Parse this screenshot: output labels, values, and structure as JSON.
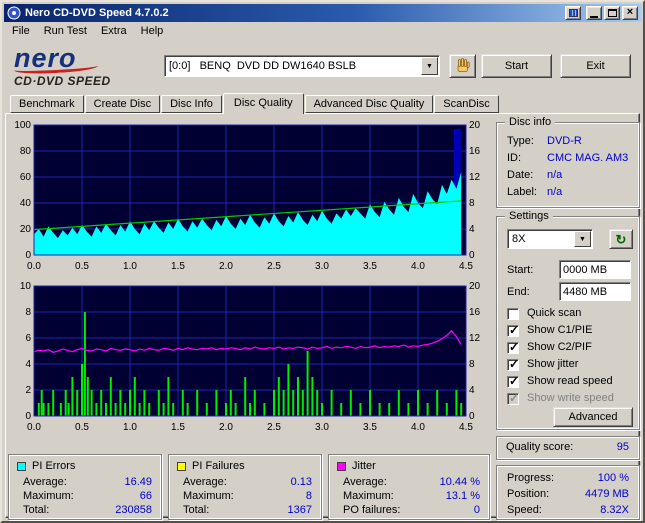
{
  "window": {
    "title": "Nero CD-DVD Speed 4.7.0.2"
  },
  "menu": {
    "items": [
      "File",
      "Run Test",
      "Extra",
      "Help"
    ]
  },
  "logo": {
    "brand": "nero",
    "product": "CD·DVD SPEED"
  },
  "toolbar": {
    "drive": "[0:0]   BENQ  DVD DD DW1640 BSLB",
    "start": "Start",
    "exit": "Exit"
  },
  "icons": {
    "chevron_down": "▼",
    "close": "×",
    "refresh": "↻"
  },
  "tabs": [
    {
      "label": "Benchmark",
      "active": false
    },
    {
      "label": "Create Disc",
      "active": false
    },
    {
      "label": "Disc Info",
      "active": false
    },
    {
      "label": "Disc Quality",
      "active": true
    },
    {
      "label": "Advanced Disc Quality",
      "active": false
    },
    {
      "label": "ScanDisc",
      "active": false
    }
  ],
  "disc_info": {
    "title": "Disc info",
    "rows": [
      {
        "label": "Type:",
        "value": "DVD-R"
      },
      {
        "label": "ID:",
        "value": "CMC MAG. AM3"
      },
      {
        "label": "Date:",
        "value": "n/a"
      },
      {
        "label": "Label:",
        "value": "n/a"
      }
    ]
  },
  "settings": {
    "title": "Settings",
    "speed": "8X",
    "start_label": "Start:",
    "start_value": "0000 MB",
    "end_label": "End:",
    "end_value": "4480 MB",
    "checkboxes": [
      {
        "label": "Quick scan",
        "checked": false,
        "disabled": false
      },
      {
        "label": "Show C1/PIE",
        "checked": true,
        "disabled": false
      },
      {
        "label": "Show C2/PIF",
        "checked": true,
        "disabled": false
      },
      {
        "label": "Show jitter",
        "checked": true,
        "disabled": false
      },
      {
        "label": "Show read speed",
        "checked": true,
        "disabled": false
      },
      {
        "label": "Show write speed",
        "checked": true,
        "disabled": true
      }
    ],
    "advanced": "Advanced"
  },
  "quality": {
    "label": "Quality score:",
    "value": "95"
  },
  "progress": {
    "rows": [
      {
        "label": "Progress:",
        "value": "100 %"
      },
      {
        "label": "Position:",
        "value": "4479 MB"
      },
      {
        "label": "Speed:",
        "value": "8.32X"
      }
    ]
  },
  "stats": [
    {
      "name": "PI Errors",
      "color": "#00ffff",
      "rows": [
        {
          "label": "Average:",
          "value": "16.49"
        },
        {
          "label": "Maximum:",
          "value": "66"
        },
        {
          "label": "Total:",
          "value": "230858"
        }
      ]
    },
    {
      "name": "PI Failures",
      "color": "#ffff00",
      "rows": [
        {
          "label": "Average:",
          "value": "0.13"
        },
        {
          "label": "Maximum:",
          "value": "8"
        },
        {
          "label": "Total:",
          "value": "1367"
        }
      ]
    },
    {
      "name": "Jitter",
      "color": "#ff00ff",
      "rows": [
        {
          "label": "Average:",
          "value": "10.44 %"
        },
        {
          "label": "Maximum:",
          "value": "13.1 %"
        },
        {
          "label": "PO failures:",
          "value": "0"
        }
      ]
    }
  ],
  "chart_data": [
    {
      "id": "pie",
      "type": "area",
      "title": "PI Errors / read speed",
      "bg": "#000033",
      "grid": "#2222b0",
      "x_min": 0,
      "x_max": 4.5,
      "x_ticks": [
        0,
        0.5,
        1,
        1.5,
        2,
        2.5,
        3,
        3.5,
        4,
        4.5
      ],
      "left_axis": {
        "min": 0,
        "max": 100,
        "ticks": [
          0,
          20,
          40,
          60,
          80,
          100
        ]
      },
      "right_axis": {
        "min": 0,
        "max": 20,
        "ticks": [
          0,
          4,
          8,
          12,
          16,
          20
        ]
      },
      "series": [
        {
          "name": "end-spike",
          "type": "bars",
          "axis": "left",
          "color": "#0000bb",
          "bar_width": 0.07,
          "points": [
            [
              4.41,
              97
            ]
          ]
        },
        {
          "name": "pi-errors",
          "type": "area",
          "axis": "left",
          "color": "#00ffff",
          "x_start": 0,
          "x_step": 0.05,
          "y": [
            16,
            20,
            14,
            22,
            17,
            13,
            19,
            15,
            21,
            16,
            23,
            18,
            14,
            22,
            17,
            24,
            19,
            15,
            23,
            18,
            26,
            20,
            16,
            24,
            19,
            26,
            21,
            17,
            25,
            20,
            28,
            22,
            18,
            26,
            21,
            28,
            23,
            19,
            27,
            22,
            30,
            24,
            20,
            28,
            23,
            31,
            25,
            21,
            29,
            24,
            32,
            26,
            22,
            30,
            25,
            33,
            27,
            23,
            31,
            26,
            34,
            28,
            24,
            32,
            28,
            35,
            30,
            36,
            32,
            28,
            39,
            33,
            29,
            41,
            35,
            31,
            44,
            37,
            33,
            47,
            40,
            36,
            49,
            43,
            39,
            54,
            47,
            58,
            51,
            64
          ]
        },
        {
          "name": "read-speed",
          "type": "line",
          "axis": "right",
          "color": "#00cc00",
          "points": [
            [
              0,
              3.9
            ],
            [
              4.45,
              8.32
            ]
          ]
        }
      ]
    },
    {
      "id": "pif",
      "type": "bar",
      "title": "PI Failures / jitter",
      "bg": "#000033",
      "grid": "#2222b0",
      "x_min": 0,
      "x_max": 4.5,
      "x_ticks": [
        0,
        0.5,
        1,
        1.5,
        2,
        2.5,
        3,
        3.5,
        4,
        4.5
      ],
      "left_axis": {
        "min": 0,
        "max": 10,
        "ticks": [
          0,
          2,
          4,
          6,
          8,
          10
        ]
      },
      "right_axis": {
        "min": 0,
        "max": 20,
        "ticks": [
          0,
          4,
          8,
          12,
          16,
          20
        ]
      },
      "series": [
        {
          "name": "pi-failures",
          "type": "bars",
          "axis": "left",
          "color": "#00ee00",
          "bar_width": 0.02,
          "points": [
            [
              0.05,
              1
            ],
            [
              0.08,
              2
            ],
            [
              0.1,
              1
            ],
            [
              0.15,
              1
            ],
            [
              0.2,
              2
            ],
            [
              0.28,
              1
            ],
            [
              0.33,
              2
            ],
            [
              0.36,
              1
            ],
            [
              0.4,
              3
            ],
            [
              0.45,
              2
            ],
            [
              0.5,
              4
            ],
            [
              0.53,
              8
            ],
            [
              0.56,
              3
            ],
            [
              0.6,
              2
            ],
            [
              0.65,
              1
            ],
            [
              0.7,
              2
            ],
            [
              0.75,
              1
            ],
            [
              0.8,
              3
            ],
            [
              0.85,
              1
            ],
            [
              0.9,
              2
            ],
            [
              0.95,
              1
            ],
            [
              1.0,
              2
            ],
            [
              1.05,
              3
            ],
            [
              1.1,
              1
            ],
            [
              1.15,
              2
            ],
            [
              1.2,
              1
            ],
            [
              1.3,
              2
            ],
            [
              1.35,
              1
            ],
            [
              1.4,
              3
            ],
            [
              1.45,
              1
            ],
            [
              1.55,
              2
            ],
            [
              1.6,
              1
            ],
            [
              1.7,
              2
            ],
            [
              1.8,
              1
            ],
            [
              1.9,
              2
            ],
            [
              2.0,
              1
            ],
            [
              2.05,
              2
            ],
            [
              2.1,
              1
            ],
            [
              2.2,
              3
            ],
            [
              2.25,
              1
            ],
            [
              2.3,
              2
            ],
            [
              2.4,
              1
            ],
            [
              2.5,
              2
            ],
            [
              2.55,
              3
            ],
            [
              2.6,
              2
            ],
            [
              2.65,
              4
            ],
            [
              2.7,
              2
            ],
            [
              2.75,
              3
            ],
            [
              2.8,
              2
            ],
            [
              2.85,
              5
            ],
            [
              2.9,
              3
            ],
            [
              2.95,
              2
            ],
            [
              3.0,
              1
            ],
            [
              3.1,
              2
            ],
            [
              3.2,
              1
            ],
            [
              3.3,
              2
            ],
            [
              3.4,
              1
            ],
            [
              3.5,
              2
            ],
            [
              3.6,
              1
            ],
            [
              3.7,
              1
            ],
            [
              3.8,
              2
            ],
            [
              3.9,
              1
            ],
            [
              4.0,
              2
            ],
            [
              4.1,
              1
            ],
            [
              4.2,
              2
            ],
            [
              4.3,
              1
            ],
            [
              4.4,
              2
            ],
            [
              4.45,
              1
            ]
          ]
        },
        {
          "name": "jitter",
          "type": "line",
          "axis": "right",
          "color": "#ff00ff",
          "x_start": 0,
          "x_step": 0.05,
          "y": [
            9.9,
            10.1,
            10.0,
            10.2,
            9.8,
            10.0,
            10.3,
            10.1,
            9.9,
            10.2,
            10.4,
            10.1,
            10.0,
            10.3,
            10.2,
            10.0,
            10.4,
            10.2,
            10.1,
            10.3,
            10.2,
            10.0,
            10.3,
            10.1,
            10.4,
            10.2,
            10.1,
            10.4,
            10.3,
            10.1,
            10.4,
            10.2,
            10.5,
            10.3,
            10.2,
            10.4,
            10.3,
            10.5,
            10.2,
            10.4,
            10.3,
            10.5,
            10.4,
            10.2,
            10.5,
            10.3,
            10.6,
            10.4,
            10.3,
            10.5,
            10.4,
            10.6,
            10.3,
            10.5,
            10.4,
            10.6,
            10.5,
            10.3,
            10.6,
            10.4,
            10.5,
            10.7,
            10.4,
            10.6,
            10.5,
            10.7,
            10.6,
            10.4,
            10.7,
            10.5,
            10.6,
            10.8,
            10.5,
            10.7,
            10.6,
            10.8,
            10.7,
            10.9,
            10.6,
            10.8,
            10.7,
            10.9,
            11.0,
            11.2,
            11.5,
            11.9,
            12.4,
            13.1,
            12.2,
            11.0
          ]
        }
      ]
    }
  ]
}
